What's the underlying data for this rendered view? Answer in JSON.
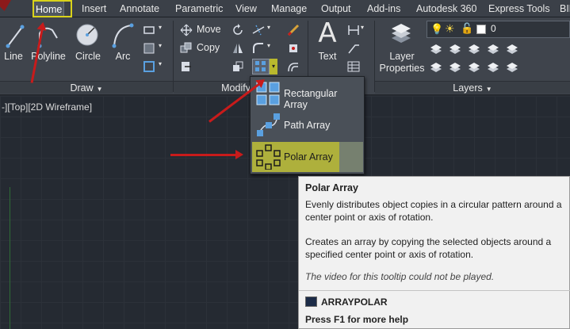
{
  "tabs": [
    {
      "label": "Home",
      "active": true
    },
    {
      "label": "Insert"
    },
    {
      "label": "Annotate"
    },
    {
      "label": "Parametric"
    },
    {
      "label": "View"
    },
    {
      "label": "Manage"
    },
    {
      "label": "Output"
    },
    {
      "label": "Add-ins"
    },
    {
      "label": "Autodesk 360"
    },
    {
      "label": "Express Tools"
    },
    {
      "label": "BIM"
    }
  ],
  "ribbon": {
    "draw": {
      "line": "Line",
      "polyline": "Polyline",
      "circle": "Circle",
      "arc": "Arc",
      "panel_label": "Draw"
    },
    "modify": {
      "move": "Move",
      "copy": "Copy",
      "panel_label": "Modify"
    },
    "annotation": {
      "text": "Text"
    },
    "layers": {
      "layer_properties_line1": "Layer",
      "layer_properties_line2": "Properties",
      "layer_value": "0",
      "panel_label": "Layers"
    }
  },
  "viewport_label": "-][Top][2D Wireframe]",
  "array_menu": {
    "items": [
      {
        "label": "Rectangular Array"
      },
      {
        "label": "Path Array"
      },
      {
        "label": "Polar Array",
        "selected": true
      }
    ]
  },
  "tooltip": {
    "title": "Polar Array",
    "desc1": "Evenly distributes object copies in a circular pattern around a center point or axis of rotation.",
    "desc2": "Creates an array by copying the selected objects around a specified center point or axis of rotation.",
    "note": "The video for this tooltip could not be played.",
    "command": "ARRAYPOLAR",
    "help": "Press F1 for more help"
  },
  "colors": {
    "accent_yellow": "#d9d21a",
    "annotation_red": "#c81b1b",
    "ribbon_bg": "#3f444c"
  }
}
